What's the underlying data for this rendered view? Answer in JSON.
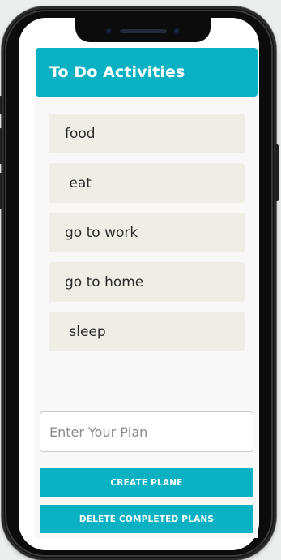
{
  "app": {
    "title": "To Do Activities"
  },
  "todos": [
    {
      "label": "food"
    },
    {
      "label": " eat"
    },
    {
      "label": "go to work"
    },
    {
      "label": "go to home"
    },
    {
      "label": " sleep"
    }
  ],
  "plan_input": {
    "value": "",
    "placeholder": "Enter Your Plan"
  },
  "buttons": {
    "create_label": "CREATE PLANE",
    "delete_label": "DELETE COMPLETED PLANS"
  },
  "colors": {
    "accent": "#0ab1c3",
    "item_background": "#f0ece6",
    "page_background": "#eceded",
    "phone_frame": "#0c0c0c"
  },
  "icons": {
    "front_camera": "camera-icon",
    "speaker": "speaker-grille"
  }
}
